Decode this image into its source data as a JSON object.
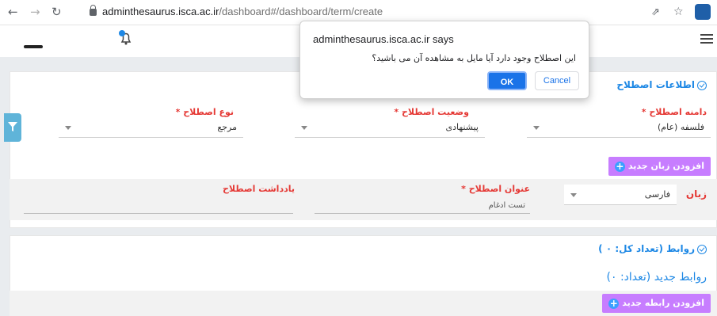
{
  "browser": {
    "url_host": "adminthesaurus.isca.ac.ir",
    "url_path": "/dashboard#/dashboard/term/create"
  },
  "dialog": {
    "title": "adminthesaurus.isca.ac.ir says",
    "message": "این اصطلاح وجود دارد آیا مایل به مشاهده آن می باشید؟",
    "ok_label": "OK",
    "cancel_label": "Cancel"
  },
  "term_info": {
    "section_title": "اطلاعات اصطلاح",
    "domain_label": "دامنه اصطلاح *",
    "domain_value": "فلسفه (عام)",
    "status_label": "وضعیت اصطلاح *",
    "status_value": "پیشنهادی",
    "type_label": "نوع اصطلاح *",
    "type_value": "مرجع",
    "add_language_label": "افزودن زبان جدید",
    "language_label": "زبان",
    "language_value": "فارسی",
    "term_title_label": "عنوان اصطلاح *",
    "term_title_value": "تست ادغام",
    "term_note_label": "یادداشت اصطلاح"
  },
  "relations": {
    "section_title": "روابط (تعداد کل: ۰ )",
    "new_relations_title": "روابط جدید (تعداد: ۰)",
    "add_relation_label": "افزودن رابطه جدید"
  },
  "colors": {
    "accent_blue": "#1e88e5",
    "required_red": "#e53935",
    "add_button_purple": "#c77dff",
    "ok_blue": "#1a73e8"
  }
}
